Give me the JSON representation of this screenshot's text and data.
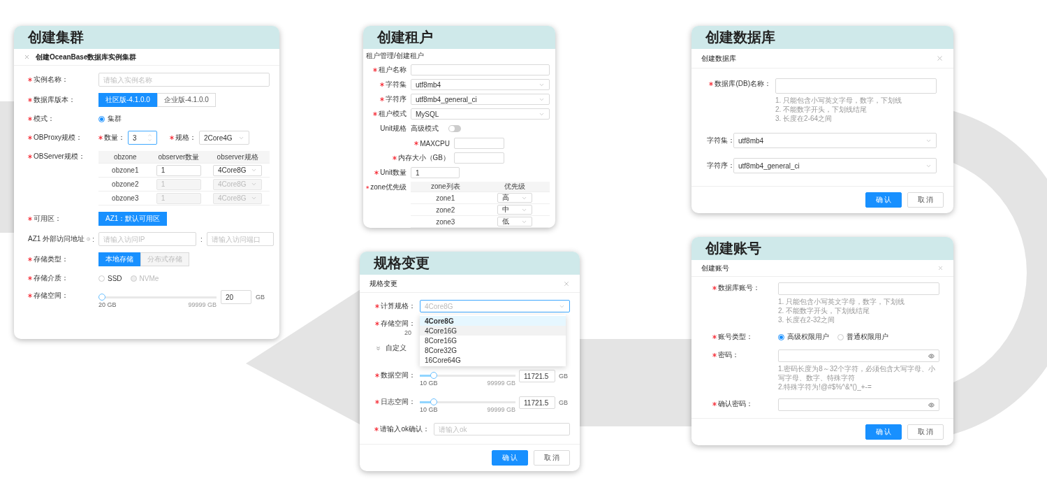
{
  "create_cluster": {
    "title": "创建集群",
    "dialog_title": "创建OceanBase数据库实例集群",
    "instance_name": {
      "label": "实例名称：",
      "required": true,
      "placeholder": "请输入实例名称"
    },
    "version": {
      "label": "数据库版本：",
      "required": true,
      "options": [
        {
          "label": "社区版-4.1.0.0",
          "selected": true,
          "disabled": false
        },
        {
          "label": "企业版-4.1.0.0",
          "selected": false,
          "disabled": false
        }
      ]
    },
    "mode": {
      "label": "模式：",
      "required": true,
      "options": [
        {
          "label": "集群",
          "selected": true,
          "disabled": false
        }
      ]
    },
    "obproxy": {
      "label": "OBProxy规模：",
      "required": true,
      "count_label": "数量：",
      "count": "3",
      "spec_label": "规格：",
      "spec": "2Core4G"
    },
    "observer": {
      "label": "OBServer规模：",
      "required": true,
      "columns": [
        "obzone",
        "observer数量",
        "observer规格"
      ],
      "rows": [
        {
          "zone": "obzone1",
          "count": "1",
          "spec": "4Core8G",
          "disabled": false
        },
        {
          "zone": "obzone2",
          "count": "1",
          "spec": "4Core8G",
          "disabled": true
        },
        {
          "zone": "obzone3",
          "count": "1",
          "spec": "4Core8G",
          "disabled": true
        }
      ]
    },
    "zone": {
      "label": "可用区：",
      "required": true,
      "options": [
        {
          "label": "AZ1：默认可用区",
          "selected": true
        }
      ]
    },
    "address": {
      "label": "AZ1 外部访问地址",
      "label_suffix": ":",
      "ip_placeholder": "请输入访问IP",
      "separator": ":",
      "port_placeholder": "请输入访问端口"
    },
    "storage_type": {
      "label": "存储类型：",
      "required": true,
      "options": [
        {
          "label": "本地存储",
          "selected": true,
          "disabled": false
        },
        {
          "label": "分布式存储",
          "selected": false,
          "disabled": true
        }
      ]
    },
    "medium": {
      "label": "存储介质：",
      "required": true,
      "options": [
        {
          "label": "SSD",
          "selected": false,
          "disabled": false
        },
        {
          "label": "NVMe",
          "selected": false,
          "disabled": true
        }
      ]
    },
    "space": {
      "label": "存储空间：",
      "required": true,
      "level": 0,
      "min": "20 GB",
      "max": "99999 GB",
      "value": "20",
      "unit": "GB"
    }
  },
  "create_tenant": {
    "title": "创建租户",
    "breadcrumb": "租户管理/创建租户",
    "fields": [
      {
        "kind": "input",
        "label": "租户名称",
        "required": true
      },
      {
        "kind": "select",
        "label": "字符集",
        "required": true,
        "value": "utf8mb4"
      },
      {
        "kind": "select",
        "label": "字符序",
        "required": true,
        "value": "utf8mb4_general_ci"
      },
      {
        "kind": "select",
        "label": "租户模式",
        "required": true,
        "value": "MySQL"
      },
      {
        "kind": "toggle",
        "label": "Unit规格",
        "toggle_label": "高级模式",
        "on": false
      },
      {
        "kind": "sub_input",
        "label": "MAXCPU",
        "required": true
      },
      {
        "kind": "sub_input",
        "label": "内存大小（GB）",
        "required": true
      },
      {
        "kind": "short_input",
        "label": "Unit数量",
        "required": true,
        "value": "1"
      }
    ],
    "zone_priority": {
      "label": "zone优先级",
      "required": true,
      "columns": [
        "zone列表",
        "优先级"
      ],
      "rows": [
        {
          "zone": "zone1",
          "priority": "高"
        },
        {
          "zone": "zone2",
          "priority": "中"
        },
        {
          "zone": "zone3",
          "priority": "低"
        }
      ]
    }
  },
  "create_database": {
    "title": "创建数据库",
    "dialog_title": "创建数据库",
    "name": {
      "label": "数据库(DB)名称：",
      "required": true,
      "hints": [
        "1. 只能包含小写英文字母，数字，下划线",
        "2. 不能数字开头，下划线结尾",
        "3. 长度在2-64之间"
      ]
    },
    "charset": {
      "label": "字符集：",
      "value": "utf8mb4"
    },
    "collation": {
      "label": "字符序：",
      "value": "utf8mb4_general_ci"
    },
    "buttons": [
      {
        "label": "确 认",
        "primary": true
      },
      {
        "label": "取 消",
        "primary": false
      }
    ]
  },
  "resize": {
    "title": "规格变更",
    "dialog_title": "规格变更",
    "spec": {
      "label": "计算规格：",
      "required": true,
      "placeholder": "4Core8G",
      "options": [
        {
          "label": "4Core8G",
          "selected": true,
          "hovered": false
        },
        {
          "label": "4Core16G",
          "selected": false,
          "hovered": true
        },
        {
          "label": "8Core16G",
          "selected": false,
          "hovered": false
        },
        {
          "label": "8Core32G",
          "selected": false,
          "hovered": false
        },
        {
          "label": "16Core64G",
          "selected": false,
          "hovered": false
        }
      ]
    },
    "storage": {
      "label": "存储空间：",
      "required": true,
      "fragment": "20"
    },
    "custom": {
      "label": "自定义",
      "expanded": true
    },
    "sliders": [
      {
        "label": "数据空间：",
        "required": true,
        "level": 0.12,
        "min": "10 GB",
        "max": "99999 GB",
        "value": "11721.5",
        "unit": "GB"
      },
      {
        "label": "日志空间：",
        "required": true,
        "level": 0.12,
        "min": "10 GB",
        "max": "99999 GB",
        "value": "11721.5",
        "unit": "GB"
      }
    ],
    "confirm": {
      "label": "请输入ok确认：",
      "required": true,
      "placeholder": "请输入ok"
    },
    "buttons": [
      {
        "label": "确 认",
        "primary": true
      },
      {
        "label": "取 消",
        "primary": false
      }
    ]
  },
  "create_account": {
    "title": "创建账号",
    "dialog_title": "创建账号",
    "account": {
      "label": "数据库账号：",
      "required": true,
      "hints": [
        "1. 只能包含小写英文字母，数字，下划线",
        "2. 不能数字开头，下划线结尾",
        "3. 长度在2-32之间"
      ]
    },
    "type": {
      "label": "账号类型：",
      "required": true,
      "options": [
        {
          "label": "高级权限用户",
          "selected": true
        },
        {
          "label": "普通权限用户",
          "selected": false
        }
      ]
    },
    "password": {
      "label": "密码：",
      "required": true,
      "hints": [
        "1.密码长度为8～32个字符，必须包含大写字母、小写字母、数字、特殊字符",
        "2.特殊字符为!@#$%^&*()_+-="
      ]
    },
    "confirm": {
      "label": "确认密码：",
      "required": true
    },
    "buttons": [
      {
        "label": "确 认",
        "primary": true
      },
      {
        "label": "取 消",
        "primary": false
      }
    ]
  }
}
